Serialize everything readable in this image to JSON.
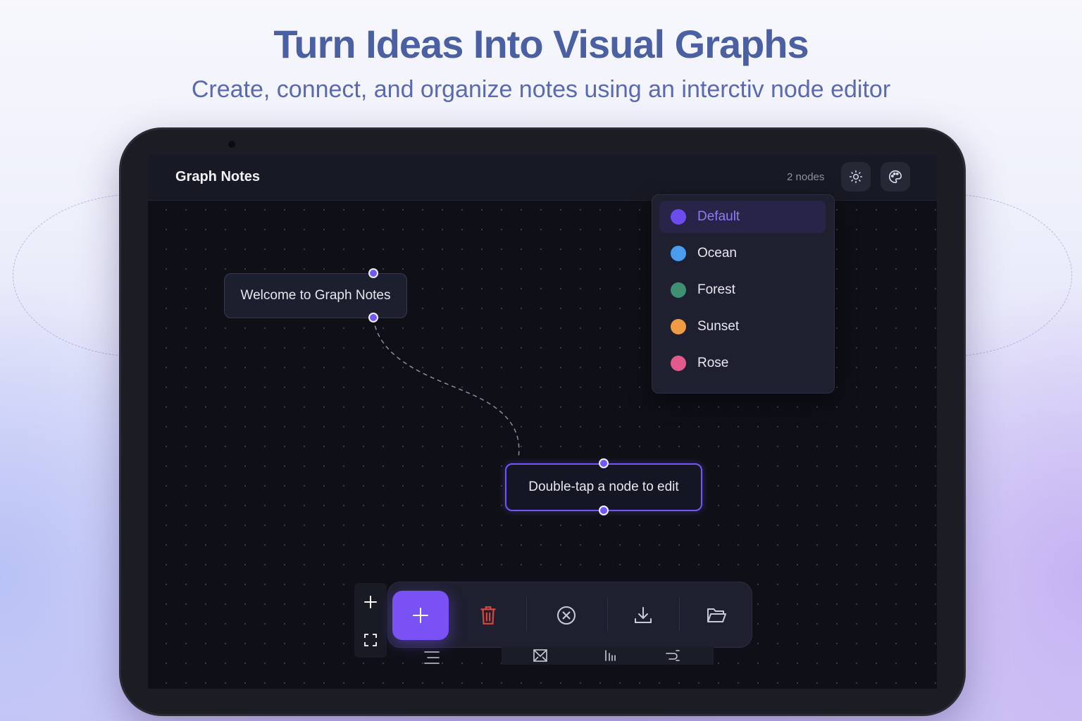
{
  "hero": {
    "title": "Turn Ideas Into Visual Graphs",
    "subtitle": "Create, connect, and organize notes using an interctiv node editor"
  },
  "app": {
    "title": "Graph Notes",
    "node_count": "2 nodes",
    "header_buttons": [
      {
        "icon": "sun-icon"
      },
      {
        "icon": "palette-icon"
      }
    ]
  },
  "theme_menu": {
    "selected": "Default",
    "items": [
      {
        "label": "Default",
        "color": "#6c4cf0"
      },
      {
        "label": "Ocean",
        "color": "#4a9cf0"
      },
      {
        "label": "Forest",
        "color": "#3f8f73"
      },
      {
        "label": "Sunset",
        "color": "#f09a44"
      },
      {
        "label": "Rose",
        "color": "#e05a8c"
      }
    ]
  },
  "nodes": [
    {
      "label": "Welcome to Graph Notes",
      "selected": false
    },
    {
      "label": "Double-tap a node to edit",
      "selected": true
    }
  ],
  "toolbar": {
    "buttons": [
      {
        "icon": "plus-icon",
        "primary": true
      },
      {
        "icon": "trash-icon",
        "color": "#d9473f"
      },
      {
        "icon": "close-circle-icon"
      },
      {
        "icon": "download-icon"
      },
      {
        "icon": "folder-open-icon"
      }
    ],
    "sub_buttons": [
      {
        "icon": "image-export-icon"
      },
      {
        "icon": "chart-icon"
      },
      {
        "icon": "share-icon"
      }
    ]
  },
  "zoom_controls": [
    {
      "icon": "zoom-in-icon"
    },
    {
      "icon": "fit-view-icon"
    }
  ],
  "colors": {
    "accent": "#7a51f5",
    "canvas": "#0f1017"
  }
}
